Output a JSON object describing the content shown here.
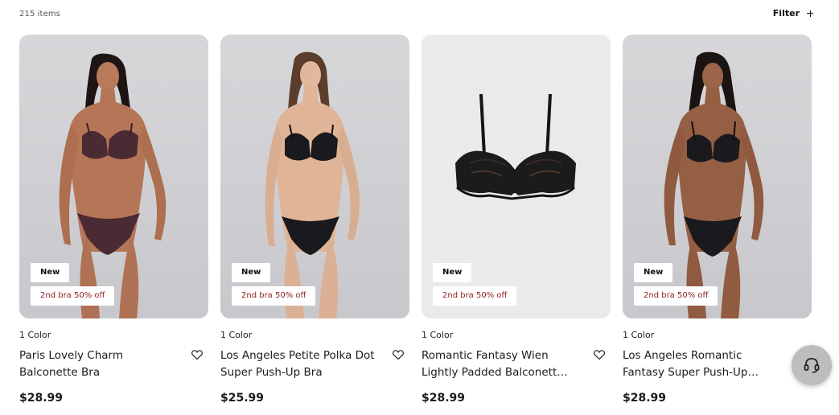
{
  "listing": {
    "item_count": "215 items",
    "filter_label": "Filter"
  },
  "products": [
    {
      "badge_new": "New",
      "badge_promo": "2nd bra 50% off",
      "colors": "1 Color",
      "title": "Paris Lovely Charm Balconette Bra",
      "price": "$28.99",
      "image": "model-burgundy",
      "color": "#4a2a33"
    },
    {
      "badge_new": "New",
      "badge_promo": "2nd bra 50% off",
      "colors": "1 Color",
      "title": "Los Angeles Petite Polka Dot Super Push-Up Bra",
      "price": "$25.99",
      "image": "model-black",
      "color": "#1a1a1e"
    },
    {
      "badge_new": "New",
      "badge_promo": "2nd bra 50% off",
      "colors": "1 Color",
      "title": "Romantic Fantasy Wien Lightly Padded Balconett…",
      "price": "$28.99",
      "image": "product-black-lace-bra",
      "color": "#151515"
    },
    {
      "badge_new": "New",
      "badge_promo": "2nd bra 50% off",
      "colors": "1 Color",
      "title": "Los Angeles Romantic Fantasy Super Push-Up…",
      "price": "$28.99",
      "image": "model-black-lace",
      "color": "#1a1a1e"
    }
  ],
  "icons": {
    "heart": "heart-icon",
    "plus": "plus-icon",
    "support": "headset-icon"
  }
}
